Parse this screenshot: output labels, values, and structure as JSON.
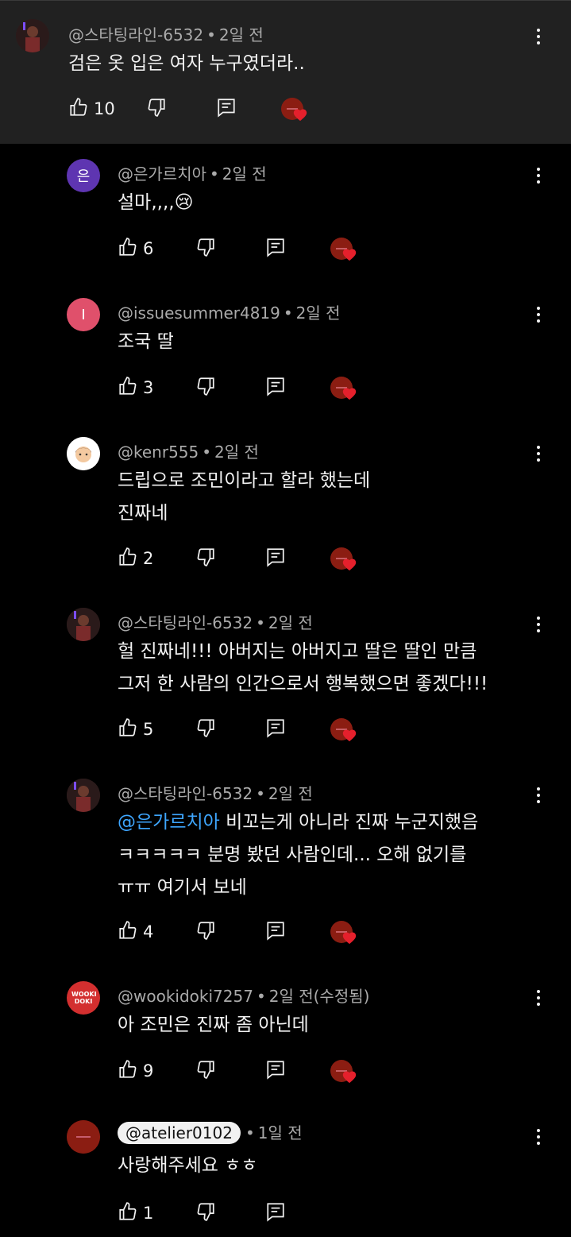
{
  "comments": [
    {
      "handle": "@스타팅라인-6532",
      "time": "2일 전",
      "lines": [
        "검은 옷 입은 여자 누구였더라.."
      ],
      "likes": "10",
      "avatar": "photo"
    },
    {
      "handle": "@은가르치아",
      "time": "2일 전",
      "lines": [
        "설마,,,,😢"
      ],
      "likes": "6",
      "avatar": "은",
      "avatar_color": "#5e35b1"
    },
    {
      "handle": "@issuesummer4819",
      "time": "2일 전",
      "lines": [
        "조국 딸"
      ],
      "likes": "3",
      "avatar": "I",
      "avatar_color": "#e0506b"
    },
    {
      "handle": "@kenr555",
      "time": "2일 전",
      "lines": [
        "드립으로 조민이라고 할라 했는데",
        "진짜네"
      ],
      "likes": "2",
      "avatar": "face"
    },
    {
      "handle": "@스타팅라인-6532",
      "time": "2일 전",
      "lines": [
        "헐 진짜네!!! 아버지는 아버지고 딸은 딸인 만큼",
        "그저 한 사람의 인간으로서 행복했으면 좋겠다!!!"
      ],
      "likes": "5",
      "avatar": "photo"
    },
    {
      "handle": "@스타팅라인-6532",
      "time": "2일 전",
      "mention": "@은가르치아",
      "lines": [
        " 비꼬는게 아니라 진짜 누군지했음",
        "ㅋㅋㅋㅋㅋ 분명 봤던 사람인데... 오해 없기를",
        "ㅠㅠ 여기서 보네"
      ],
      "likes": "4",
      "avatar": "photo"
    },
    {
      "handle": "@wookidoki7257",
      "time": "2일 전(수정됨)",
      "lines": [
        "아 조민은 진짜 좀 아닌데"
      ],
      "likes": "9",
      "avatar": "wooki",
      "avatar_text": "WOOKI DOKI"
    },
    {
      "handle": "@atelier0102",
      "time": "1일 전",
      "lines": [
        "사랑해주세요 ㅎㅎ"
      ],
      "likes": "1",
      "avatar": "atelier"
    }
  ],
  "colors": {
    "accent_mention": "#3ea6ff",
    "parent_bg": "#212121",
    "heart": "#e5202c"
  },
  "icons": {
    "like": "thumb-up-icon",
    "dislike": "thumb-down-icon",
    "reply": "reply-icon",
    "more": "more-vert-icon",
    "creator_heart": "creator-heart-icon"
  }
}
